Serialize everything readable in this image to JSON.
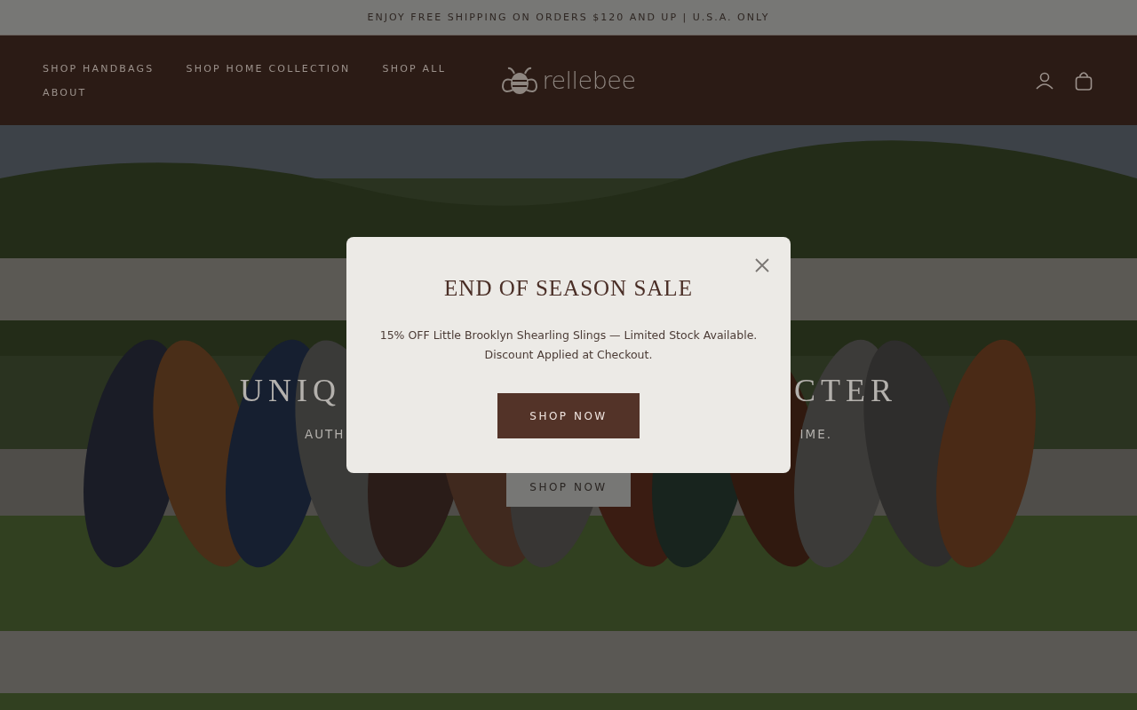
{
  "announcement": "ENJOY FREE SHIPPING ON ORDERS $120 AND UP | U.S.A. ONLY",
  "header": {
    "nav": [
      "SHOP HANDBAGS",
      "SHOP HOME COLLECTION",
      "SHOP ALL",
      "ABOUT"
    ],
    "logo": "rellebee"
  },
  "hero": {
    "kind": "picture",
    "heading_parts": [
      "UNIQ",
      "CTER"
    ],
    "subtitle_parts": [
      "AUTH",
      "IME."
    ],
    "button": "SHOP NOW"
  },
  "modal": {
    "title": "END OF SEASON SALE",
    "lines": [
      "15% OFF Little Brooklyn Shearling Slings — Limited Stock Available.",
      "Discount Applied at Checkout."
    ],
    "button": "SHOP NOW"
  }
}
